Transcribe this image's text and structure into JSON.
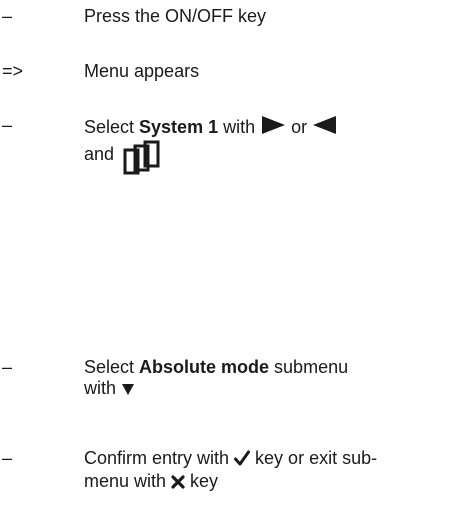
{
  "steps": [
    {
      "marker": "–",
      "text": "Press the ON/OFF key"
    },
    {
      "marker": "=>",
      "text": "Menu appears"
    },
    {
      "marker": "–",
      "text_before": "Select ",
      "bold": "System 1",
      "text_with": " with ",
      "or": " or ",
      "line2_prefix": "and",
      "icons": [
        "triangle-right-icon",
        "triangle-left-icon",
        "menu-pages-icon"
      ]
    },
    {
      "marker": "–",
      "text_before": "Select ",
      "bold": "Absolute mode",
      "text_after": " submenu",
      "line2_prefix": "with ",
      "icons": [
        "triangle-down-icon"
      ]
    },
    {
      "marker": "–",
      "line1_before": "Confirm entry with ",
      "line1_after": " key or exit sub-",
      "line2_before": "menu with ",
      "line2_after": " key",
      "icons": [
        "check-icon",
        "cross-icon"
      ]
    }
  ]
}
